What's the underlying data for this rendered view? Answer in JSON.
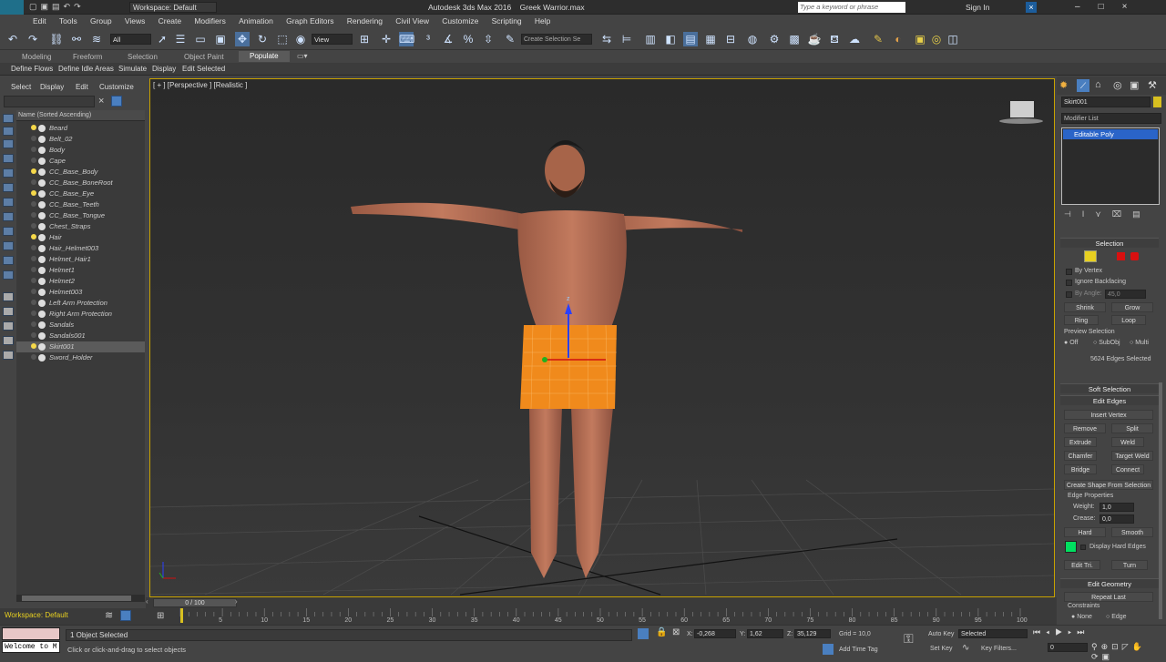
{
  "window": {
    "logo": "MAX",
    "workspace_label": "Workspace: Default",
    "title": "Autodesk 3ds Max 2016    Greek Warrior.max",
    "search_placeholder": "Type a keyword or phrase",
    "signin": "Sign In"
  },
  "menu": [
    "Edit",
    "Tools",
    "Group",
    "Views",
    "Create",
    "Modifiers",
    "Animation",
    "Graph Editors",
    "Rendering",
    "Civil View",
    "Customize",
    "Scripting",
    "Help"
  ],
  "toolbar": {
    "filter_value": "All",
    "refcoord_value": "View",
    "selection_set": "Create Selection Se"
  },
  "ribbon": {
    "tabs": [
      "Modeling",
      "Freeform",
      "Selection",
      "Object Paint",
      "Populate"
    ],
    "active_tab": "Populate",
    "items": [
      "Define Flows",
      "Define Idle Areas",
      "Simulate",
      "Display",
      "Edit Selected"
    ]
  },
  "explorer": {
    "menu": [
      "Select",
      "Display",
      "Edit",
      "Customize"
    ],
    "header": "Name (Sorted Ascending)",
    "items": [
      {
        "name": "Beard",
        "lit": true
      },
      {
        "name": "Belt_02",
        "lit": false
      },
      {
        "name": "Body",
        "lit": false
      },
      {
        "name": "Cape",
        "lit": false
      },
      {
        "name": "CC_Base_Body",
        "lit": true
      },
      {
        "name": "CC_Base_BoneRoot",
        "lit": false
      },
      {
        "name": "CC_Base_Eye",
        "lit": true
      },
      {
        "name": "CC_Base_Teeth",
        "lit": false
      },
      {
        "name": "CC_Base_Tongue",
        "lit": false
      },
      {
        "name": "Chest_Straps",
        "lit": false
      },
      {
        "name": "Hair",
        "lit": true
      },
      {
        "name": "Hair_Helmet003",
        "lit": false
      },
      {
        "name": "Helmet_Hair1",
        "lit": false
      },
      {
        "name": "Helmet1",
        "lit": false
      },
      {
        "name": "Helmet2",
        "lit": false
      },
      {
        "name": "Helmet003",
        "lit": false
      },
      {
        "name": "Left Arm Protection",
        "lit": false
      },
      {
        "name": "Right Arm Protection",
        "lit": false
      },
      {
        "name": "Sandals",
        "lit": false
      },
      {
        "name": "Sandals001",
        "lit": false
      },
      {
        "name": "Skirt001",
        "lit": true
      },
      {
        "name": "Sword_Holder",
        "lit": false
      }
    ],
    "selected": "Skirt001"
  },
  "viewport": {
    "label": "[ + ] [Perspective ] [Realistic ]",
    "axis_z": "z"
  },
  "command_panel": {
    "object_name": "Skirt001",
    "modifier_list": "Modifier List",
    "stack_item": "Editable Poly",
    "selection": {
      "header": "Selection",
      "by_vertex": "By Vertex",
      "ignore_backfacing": "Ignore Backfacing",
      "by_angle": "By Angle:",
      "angle_value": "45,0",
      "shrink": "Shrink",
      "grow": "Grow",
      "ring": "Ring",
      "loop": "Loop",
      "preview_label": "Preview Selection",
      "preview_off": "Off",
      "preview_subobj": "SubObj",
      "preview_multi": "Multi",
      "status": "5624 Edges Selected"
    },
    "soft_selection": "Soft Selection",
    "edit_edges": {
      "header": "Edit Edges",
      "insert_vertex": "Insert Vertex",
      "remove": "Remove",
      "split": "Split",
      "extrude": "Extrude",
      "weld": "Weld",
      "chamfer": "Chamfer",
      "target_weld": "Target Weld",
      "bridge": "Bridge",
      "connect": "Connect",
      "create_shape": "Create Shape From Selection",
      "edge_properties": "Edge Properties",
      "weight_label": "Weight:",
      "weight_value": "1,0",
      "crease_label": "Crease:",
      "crease_value": "0,0",
      "hard": "Hard",
      "smooth": "Smooth",
      "display_hard": "Display Hard Edges",
      "hard_color": "#00e060",
      "edit_tri": "Edit Tri.",
      "turn": "Turn"
    },
    "edit_geometry": {
      "header": "Edit Geometry",
      "repeat_last": "Repeat Last",
      "constraints": "Constraints",
      "none": "None",
      "edge": "Edge"
    }
  },
  "timeline": {
    "frame": "0 / 100",
    "ticks": [
      "0",
      "5",
      "10",
      "15",
      "20",
      "25",
      "30",
      "35",
      "40",
      "45",
      "50",
      "55",
      "60",
      "65",
      "70",
      "75",
      "80",
      "85",
      "90",
      "95",
      "100"
    ]
  },
  "status": {
    "workspace": "Workspace: Default",
    "maxscript": "Welcome to M",
    "selected": "1 Object Selected",
    "prompt": "Click or click-and-drag to select objects",
    "x_label": "X:",
    "x_value": "-0,268",
    "y_label": "Y:",
    "y_value": "1,62",
    "z_label": "Z:",
    "z_value": "35,129",
    "grid": "Grid = 10,0",
    "add_time_tag": "Add Time Tag",
    "auto_key": "Auto Key",
    "auto_key_value": "Selected",
    "set_key": "Set Key",
    "key_filters": "Key Filters...",
    "frame_value": "0"
  },
  "colors": {
    "accent": "#c8a200",
    "selected_bg": "#5b5b5b",
    "skirt": "#f08a1c"
  }
}
